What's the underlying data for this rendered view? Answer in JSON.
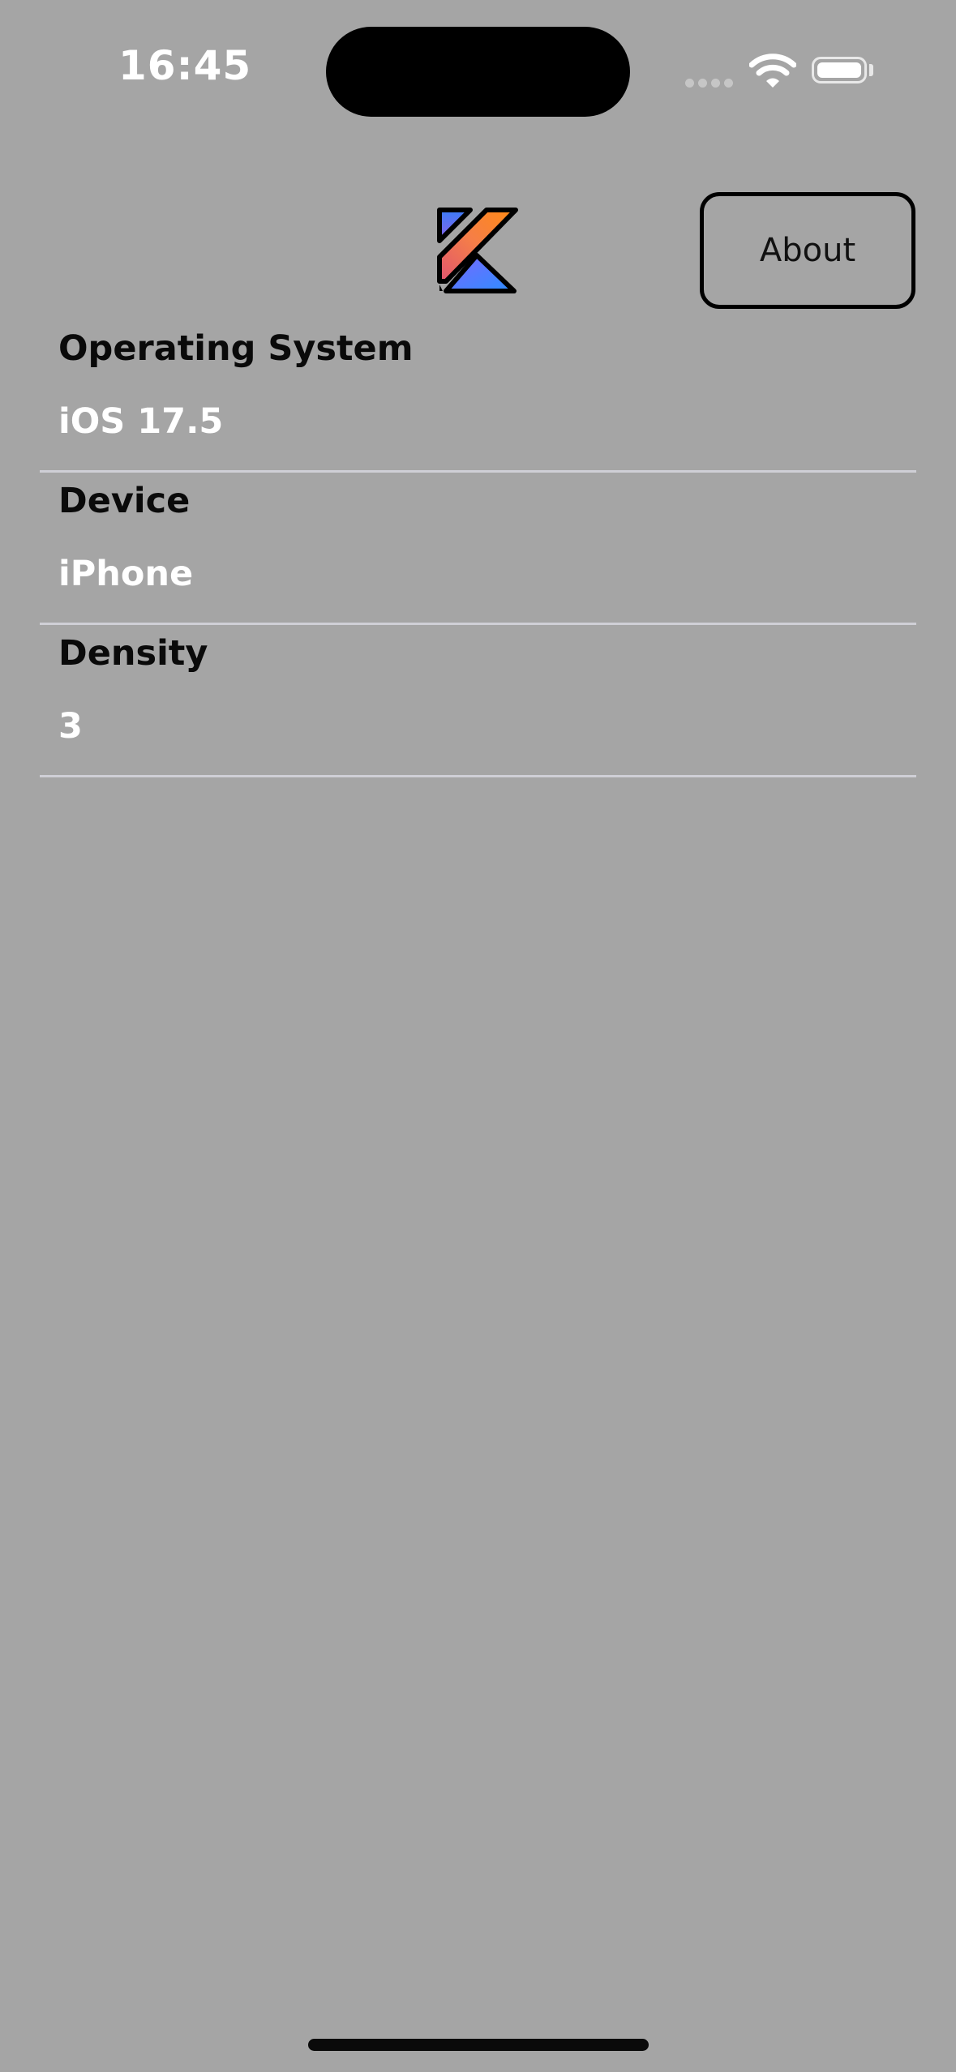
{
  "status_bar": {
    "time": "16:45"
  },
  "header": {
    "about_label": "About"
  },
  "info_list": [
    {
      "label": "Operating System",
      "value": "iOS 17.5"
    },
    {
      "label": "Device",
      "value": "iPhone"
    },
    {
      "label": "Density",
      "value": "3"
    }
  ],
  "icons": {
    "logo": "kotlin-logo-icon",
    "wifi": "wifi-icon",
    "battery": "battery-icon"
  }
}
